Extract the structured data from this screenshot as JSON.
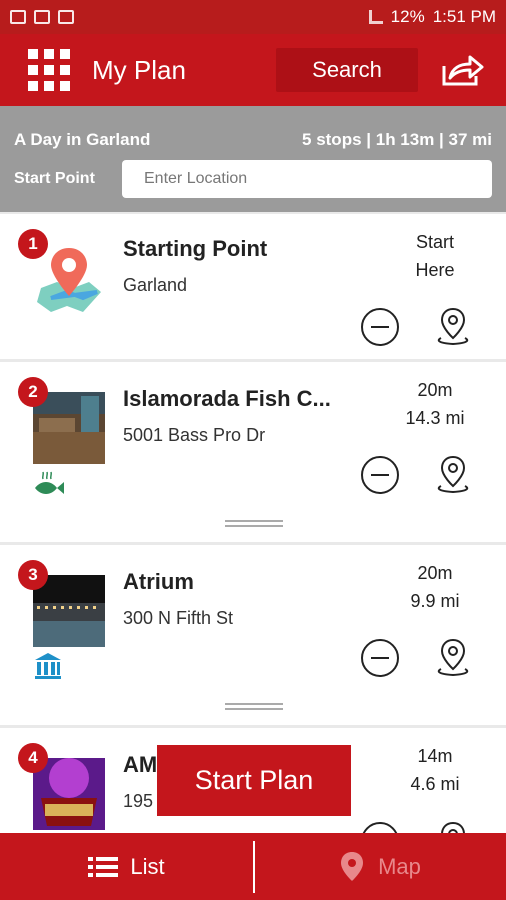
{
  "status": {
    "battery": "12%",
    "time": "1:51 PM"
  },
  "header": {
    "title": "My Plan",
    "search_label": "Search"
  },
  "plan": {
    "name": "A Day in Garland",
    "stats": "5 stops | 1h 13m | 37 mi",
    "start_label": "Start Point",
    "start_placeholder": "Enter Location"
  },
  "stops": [
    {
      "number": "1",
      "name": "Starting Point",
      "address": "Garland",
      "time": "Start",
      "distance": "Here"
    },
    {
      "number": "2",
      "name": "Islamorada Fish C...",
      "address": "5001 Bass Pro Dr",
      "time": "20m",
      "distance": "14.3 mi"
    },
    {
      "number": "3",
      "name": "Atrium",
      "address": "300 N Fifth St",
      "time": "20m",
      "distance": "9.9 mi"
    },
    {
      "number": "4",
      "name": "AM",
      "address": "195",
      "time": "14m",
      "distance": "4.6 mi"
    }
  ],
  "start_plan_label": "Start Plan",
  "tabs": {
    "list": "List",
    "map": "Map"
  },
  "colors": {
    "brand": "#c4161c",
    "header_gray": "#9b9b9b"
  }
}
